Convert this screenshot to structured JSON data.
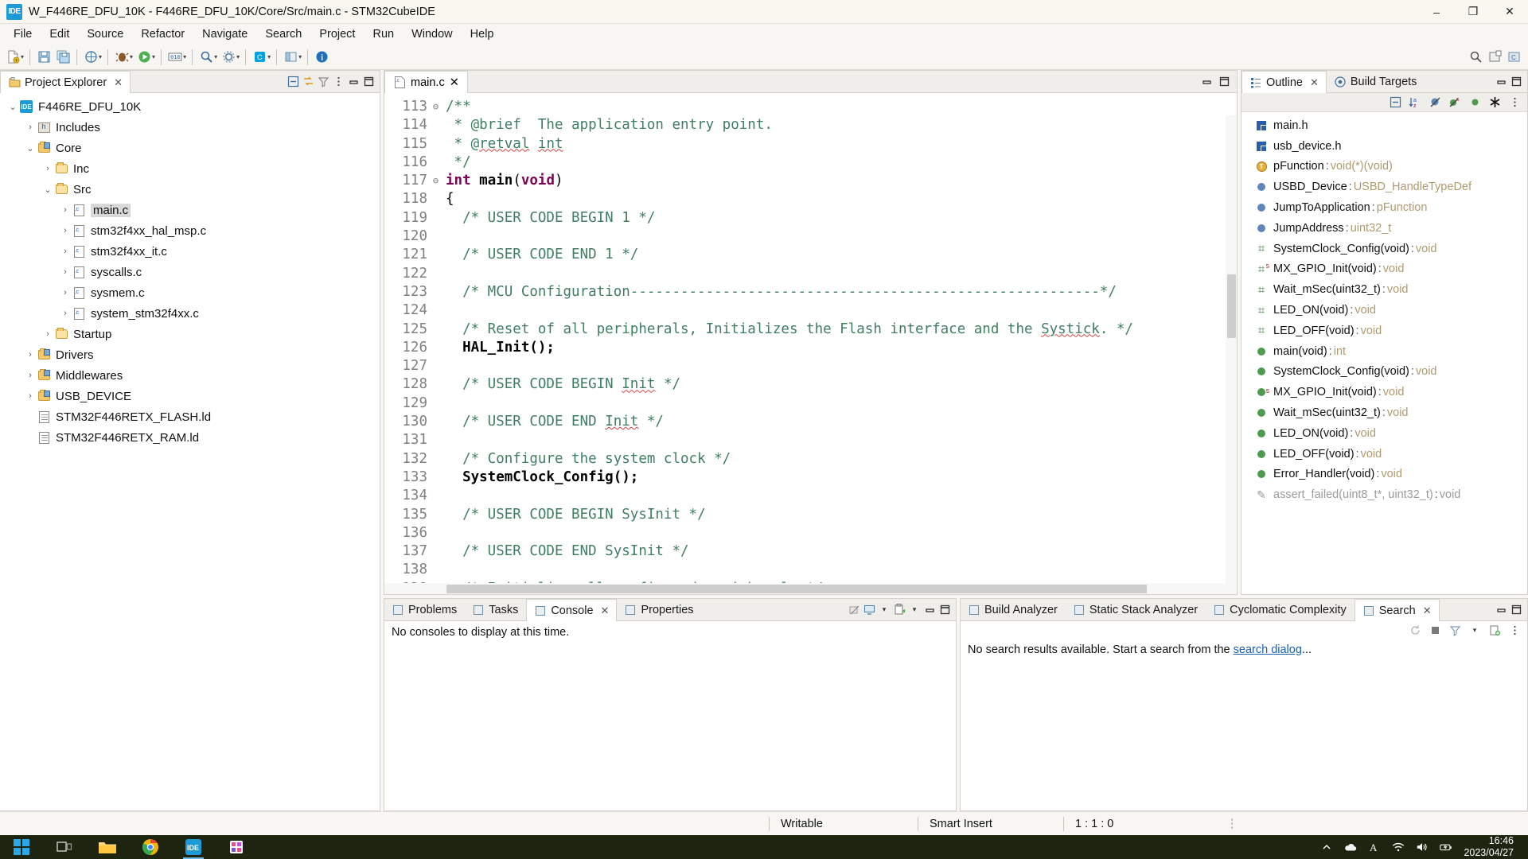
{
  "window": {
    "title": "W_F446RE_DFU_10K - F446RE_DFU_10K/Core/Src/main.c - STM32CubeIDE",
    "app_icon": "IDE",
    "minimize": "–",
    "maximize": "❐",
    "close": "✕"
  },
  "menubar": [
    "File",
    "Edit",
    "Source",
    "Refactor",
    "Navigate",
    "Search",
    "Project",
    "Run",
    "Window",
    "Help"
  ],
  "toolbar": {
    "icons": [
      "new-icon",
      "save-icon",
      "save-all-icon",
      "build-all-icon",
      "debug-icon",
      "run-icon",
      "external-tools-icon",
      "binary-icon",
      "search-icon",
      "config-icon",
      "cubemx-icon",
      "perspective-icon",
      "info-icon"
    ],
    "right_icons": [
      "quick-access-search-icon",
      "open-perspective-icon",
      "perspective-c-icon"
    ]
  },
  "project_explorer": {
    "tab_label": "Project Explorer",
    "close_icon": "✕",
    "tools": [
      "collapse-all-icon",
      "link-with-editor-icon",
      "view-filter-icon",
      "view-menu-icon",
      "minimize-icon",
      "maximize-icon"
    ],
    "tree": [
      {
        "label": "F446RE_DFU_10K",
        "indent": 0,
        "arrow": "⌄",
        "icon": "ide-project-icon",
        "selected": false
      },
      {
        "label": "Includes",
        "indent": 1,
        "arrow": "›",
        "icon": "includes-icon",
        "selected": false
      },
      {
        "label": "Core",
        "indent": 1,
        "arrow": "⌄",
        "icon": "source-folder-icon",
        "selected": false
      },
      {
        "label": "Inc",
        "indent": 2,
        "arrow": "›",
        "icon": "folder-icon",
        "selected": false
      },
      {
        "label": "Src",
        "indent": 2,
        "arrow": "⌄",
        "icon": "folder-icon",
        "selected": false
      },
      {
        "label": "main.c",
        "indent": 3,
        "arrow": "›",
        "icon": "c-file-icon",
        "selected": true
      },
      {
        "label": "stm32f4xx_hal_msp.c",
        "indent": 3,
        "arrow": "›",
        "icon": "c-file-icon",
        "selected": false
      },
      {
        "label": "stm32f4xx_it.c",
        "indent": 3,
        "arrow": "›",
        "icon": "c-file-icon",
        "selected": false
      },
      {
        "label": "syscalls.c",
        "indent": 3,
        "arrow": "›",
        "icon": "c-file-icon",
        "selected": false
      },
      {
        "label": "sysmem.c",
        "indent": 3,
        "arrow": "›",
        "icon": "c-file-icon",
        "selected": false
      },
      {
        "label": "system_stm32f4xx.c",
        "indent": 3,
        "arrow": "›",
        "icon": "c-file-icon",
        "selected": false
      },
      {
        "label": "Startup",
        "indent": 2,
        "arrow": "›",
        "icon": "folder-icon",
        "selected": false
      },
      {
        "label": "Drivers",
        "indent": 1,
        "arrow": "›",
        "icon": "source-folder-icon",
        "selected": false
      },
      {
        "label": "Middlewares",
        "indent": 1,
        "arrow": "›",
        "icon": "source-folder-icon",
        "selected": false
      },
      {
        "label": "USB_DEVICE",
        "indent": 1,
        "arrow": "›",
        "icon": "source-folder-icon",
        "selected": false
      },
      {
        "label": "STM32F446RETX_FLASH.ld",
        "indent": 1,
        "arrow": "",
        "icon": "linker-script-icon",
        "selected": false
      },
      {
        "label": "STM32F446RETX_RAM.ld",
        "indent": 1,
        "arrow": "",
        "icon": "linker-script-icon",
        "selected": false
      }
    ]
  },
  "editor": {
    "tab_label": "main.c",
    "tab_icon": "c-file-icon",
    "close_icon": "✕",
    "tools": [
      "minimize-icon",
      "maximize-icon"
    ],
    "first_line": 113,
    "lines": [
      {
        "n": 113,
        "fold": "⊖",
        "segments": [
          {
            "t": "/**",
            "c": "comment"
          }
        ]
      },
      {
        "n": 114,
        "fold": "",
        "segments": [
          {
            "t": " * @brief  The application entry point.",
            "c": "comment"
          }
        ]
      },
      {
        "n": 115,
        "fold": "",
        "segments": [
          {
            "t": " * @",
            "c": "comment"
          },
          {
            "t": "retval",
            "c": "comment-squiggle"
          },
          {
            "t": " ",
            "c": "comment"
          },
          {
            "t": "int",
            "c": "comment-squiggle"
          }
        ]
      },
      {
        "n": 116,
        "fold": "",
        "segments": [
          {
            "t": " */",
            "c": "comment"
          }
        ]
      },
      {
        "n": 117,
        "fold": "⊖",
        "segments": [
          {
            "t": "int",
            "c": "key"
          },
          {
            "t": " ",
            "c": "plain"
          },
          {
            "t": "main",
            "c": "fn"
          },
          {
            "t": "(",
            "c": "plain"
          },
          {
            "t": "void",
            "c": "key"
          },
          {
            "t": ")",
            "c": "plain"
          }
        ]
      },
      {
        "n": 118,
        "fold": "",
        "segments": [
          {
            "t": "{",
            "c": "plain"
          }
        ]
      },
      {
        "n": 119,
        "fold": "",
        "segments": [
          {
            "t": "  /* USER CODE BEGIN 1 */",
            "c": "comment"
          }
        ]
      },
      {
        "n": 120,
        "fold": "",
        "segments": [
          {
            "t": "",
            "c": "plain"
          }
        ]
      },
      {
        "n": 121,
        "fold": "",
        "segments": [
          {
            "t": "  /* USER CODE END 1 */",
            "c": "comment"
          }
        ]
      },
      {
        "n": 122,
        "fold": "",
        "segments": [
          {
            "t": "",
            "c": "plain"
          }
        ]
      },
      {
        "n": 123,
        "fold": "",
        "segments": [
          {
            "t": "  /* MCU Configuration--------------------------------------------------------*/",
            "c": "comment"
          }
        ]
      },
      {
        "n": 124,
        "fold": "",
        "segments": [
          {
            "t": "",
            "c": "plain"
          }
        ]
      },
      {
        "n": 125,
        "fold": "",
        "segments": [
          {
            "t": "  /* Reset of all peripherals, Initializes the Flash interface and the ",
            "c": "comment"
          },
          {
            "t": "Systick",
            "c": "comment-squiggle"
          },
          {
            "t": ". */",
            "c": "comment"
          }
        ]
      },
      {
        "n": 126,
        "fold": "",
        "segments": [
          {
            "t": "  HAL_Init();",
            "c": "fn"
          }
        ]
      },
      {
        "n": 127,
        "fold": "",
        "segments": [
          {
            "t": "",
            "c": "plain"
          }
        ]
      },
      {
        "n": 128,
        "fold": "",
        "segments": [
          {
            "t": "  /* USER CODE BEGIN ",
            "c": "comment"
          },
          {
            "t": "Init",
            "c": "comment-squiggle"
          },
          {
            "t": " */",
            "c": "comment"
          }
        ]
      },
      {
        "n": 129,
        "fold": "",
        "segments": [
          {
            "t": "",
            "c": "plain"
          }
        ]
      },
      {
        "n": 130,
        "fold": "",
        "segments": [
          {
            "t": "  /* USER CODE END ",
            "c": "comment"
          },
          {
            "t": "Init",
            "c": "comment-squiggle"
          },
          {
            "t": " */",
            "c": "comment"
          }
        ]
      },
      {
        "n": 131,
        "fold": "",
        "segments": [
          {
            "t": "",
            "c": "plain"
          }
        ]
      },
      {
        "n": 132,
        "fold": "",
        "segments": [
          {
            "t": "  /* Configure the system clock */",
            "c": "comment"
          }
        ]
      },
      {
        "n": 133,
        "fold": "",
        "segments": [
          {
            "t": "  SystemClock_Config();",
            "c": "fn"
          }
        ]
      },
      {
        "n": 134,
        "fold": "",
        "segments": [
          {
            "t": "",
            "c": "plain"
          }
        ]
      },
      {
        "n": 135,
        "fold": "",
        "segments": [
          {
            "t": "  /* USER CODE BEGIN SysInit */",
            "c": "comment"
          }
        ]
      },
      {
        "n": 136,
        "fold": "",
        "segments": [
          {
            "t": "",
            "c": "plain"
          }
        ]
      },
      {
        "n": 137,
        "fold": "",
        "segments": [
          {
            "t": "  /* USER CODE END SysInit */",
            "c": "comment"
          }
        ]
      },
      {
        "n": 138,
        "fold": "",
        "segments": [
          {
            "t": "",
            "c": "plain"
          }
        ]
      },
      {
        "n": 139,
        "fold": "",
        "segments": [
          {
            "t": "  /* Initialize all configured peripherals */",
            "c": "comment"
          }
        ]
      }
    ]
  },
  "outline": {
    "tabs": [
      {
        "label": "Outline",
        "icon": "outline-icon",
        "active": true,
        "closable": true
      },
      {
        "label": "Build Targets",
        "icon": "build-targets-icon",
        "active": false,
        "closable": false
      }
    ],
    "close_icon": "✕",
    "tools": [
      "collapse-all-icon",
      "sort-icon",
      "hide-fields-icon",
      "hide-static-icon",
      "hide-nonpublic-icon",
      "hide-macros-icon",
      "view-menu-icon"
    ],
    "window_tools": [
      "minimize-icon",
      "maximize-icon"
    ],
    "items": [
      {
        "name": "main.h",
        "type": "",
        "icon": "include-header-icon",
        "static": false,
        "dim": false
      },
      {
        "name": "usb_device.h",
        "type": "",
        "icon": "include-header-icon",
        "static": false,
        "dim": false
      },
      {
        "name": "pFunction",
        "type": "void(*)(void)",
        "icon": "typedef-icon",
        "static": false,
        "dim": false
      },
      {
        "name": "USBD_Device",
        "type": "USBD_HandleTypeDef",
        "icon": "variable-icon",
        "static": false,
        "dim": false
      },
      {
        "name": "JumpToApplication",
        "type": "pFunction",
        "icon": "variable-icon",
        "static": false,
        "dim": false
      },
      {
        "name": "JumpAddress",
        "type": "uint32_t",
        "icon": "variable-icon",
        "static": false,
        "dim": false
      },
      {
        "name": "SystemClock_Config(void)",
        "type": "void",
        "icon": "prototype-icon",
        "static": false,
        "dim": false
      },
      {
        "name": "MX_GPIO_Init(void)",
        "type": "void",
        "icon": "prototype-icon",
        "static": true,
        "dim": false
      },
      {
        "name": "Wait_mSec(uint32_t)",
        "type": "void",
        "icon": "prototype-icon",
        "static": false,
        "dim": false
      },
      {
        "name": "LED_ON(void)",
        "type": "void",
        "icon": "prototype-icon",
        "static": false,
        "dim": false
      },
      {
        "name": "LED_OFF(void)",
        "type": "void",
        "icon": "prototype-icon",
        "static": false,
        "dim": false
      },
      {
        "name": "main(void)",
        "type": "int",
        "icon": "function-icon",
        "static": false,
        "dim": false
      },
      {
        "name": "SystemClock_Config(void)",
        "type": "void",
        "icon": "function-icon",
        "static": false,
        "dim": false
      },
      {
        "name": "MX_GPIO_Init(void)",
        "type": "void",
        "icon": "function-icon",
        "static": true,
        "dim": false
      },
      {
        "name": "Wait_mSec(uint32_t)",
        "type": "void",
        "icon": "function-icon",
        "static": false,
        "dim": false
      },
      {
        "name": "LED_ON(void)",
        "type": "void",
        "icon": "function-icon",
        "static": false,
        "dim": false
      },
      {
        "name": "LED_OFF(void)",
        "type": "void",
        "icon": "function-icon",
        "static": false,
        "dim": false
      },
      {
        "name": "Error_Handler(void)",
        "type": "void",
        "icon": "function-icon",
        "static": false,
        "dim": false
      },
      {
        "name": "assert_failed(uint8_t*, uint32_t)",
        "type": "void",
        "icon": "macro-guard-icon",
        "static": false,
        "dim": true
      }
    ]
  },
  "console_panel": {
    "tabs": [
      {
        "label": "Problems",
        "icon": "problems-icon",
        "active": false,
        "closable": false
      },
      {
        "label": "Tasks",
        "icon": "tasks-icon",
        "active": false,
        "closable": false
      },
      {
        "label": "Console",
        "icon": "console-icon",
        "active": true,
        "closable": true
      },
      {
        "label": "Properties",
        "icon": "properties-icon",
        "active": false,
        "closable": false
      }
    ],
    "close_icon": "✕",
    "tools": [
      "clear-console-icon",
      "display-console-icon",
      "display-console-caret-icon",
      "open-console-icon",
      "open-console-caret-icon",
      "minimize-icon",
      "maximize-icon"
    ],
    "message": "No consoles to display at this time."
  },
  "search_panel": {
    "tabs": [
      {
        "label": "Build Analyzer",
        "icon": "build-analyzer-icon",
        "active": false,
        "closable": false
      },
      {
        "label": "Static Stack Analyzer",
        "icon": "static-stack-icon",
        "active": false,
        "closable": false
      },
      {
        "label": "Cyclomatic Complexity",
        "icon": "cyclomatic-icon",
        "active": false,
        "closable": false
      },
      {
        "label": "Search",
        "icon": "search-results-icon",
        "active": true,
        "closable": true
      }
    ],
    "close_icon": "✕",
    "tools": [
      "rerun-search-icon",
      "stop-icon",
      "filter-icon",
      "filter-caret-icon",
      "new-search-icon",
      "view-menu-icon"
    ],
    "window_tools": [
      "minimize-icon",
      "maximize-icon"
    ],
    "message_before": "No search results available. Start a search from the ",
    "message_link": "search dialog",
    "message_after": "..."
  },
  "statusbar": {
    "writable": "Writable",
    "insert_mode": "Smart Insert",
    "position": "1 : 1 : 0"
  },
  "taskbar": {
    "start": "windows-start-icon",
    "apps": [
      "task-view-icon",
      "file-explorer-icon",
      "chrome-icon",
      "stm32cubeide-icon",
      "store-icon"
    ],
    "tray": [
      "show-hidden-icons-icon",
      "onedrive-icon",
      "ime-icon",
      "wifi-icon",
      "volume-icon",
      "battery-icon"
    ],
    "time": "16:46",
    "date": "2023/04/27"
  },
  "colors": {
    "accent": "#1e9ad6",
    "comment": "#3f7f5f",
    "keyword": "#7f0055",
    "link": "#1a5fb4",
    "outline_type": "#b09a6e",
    "taskbar_bg": "#1d2410"
  }
}
